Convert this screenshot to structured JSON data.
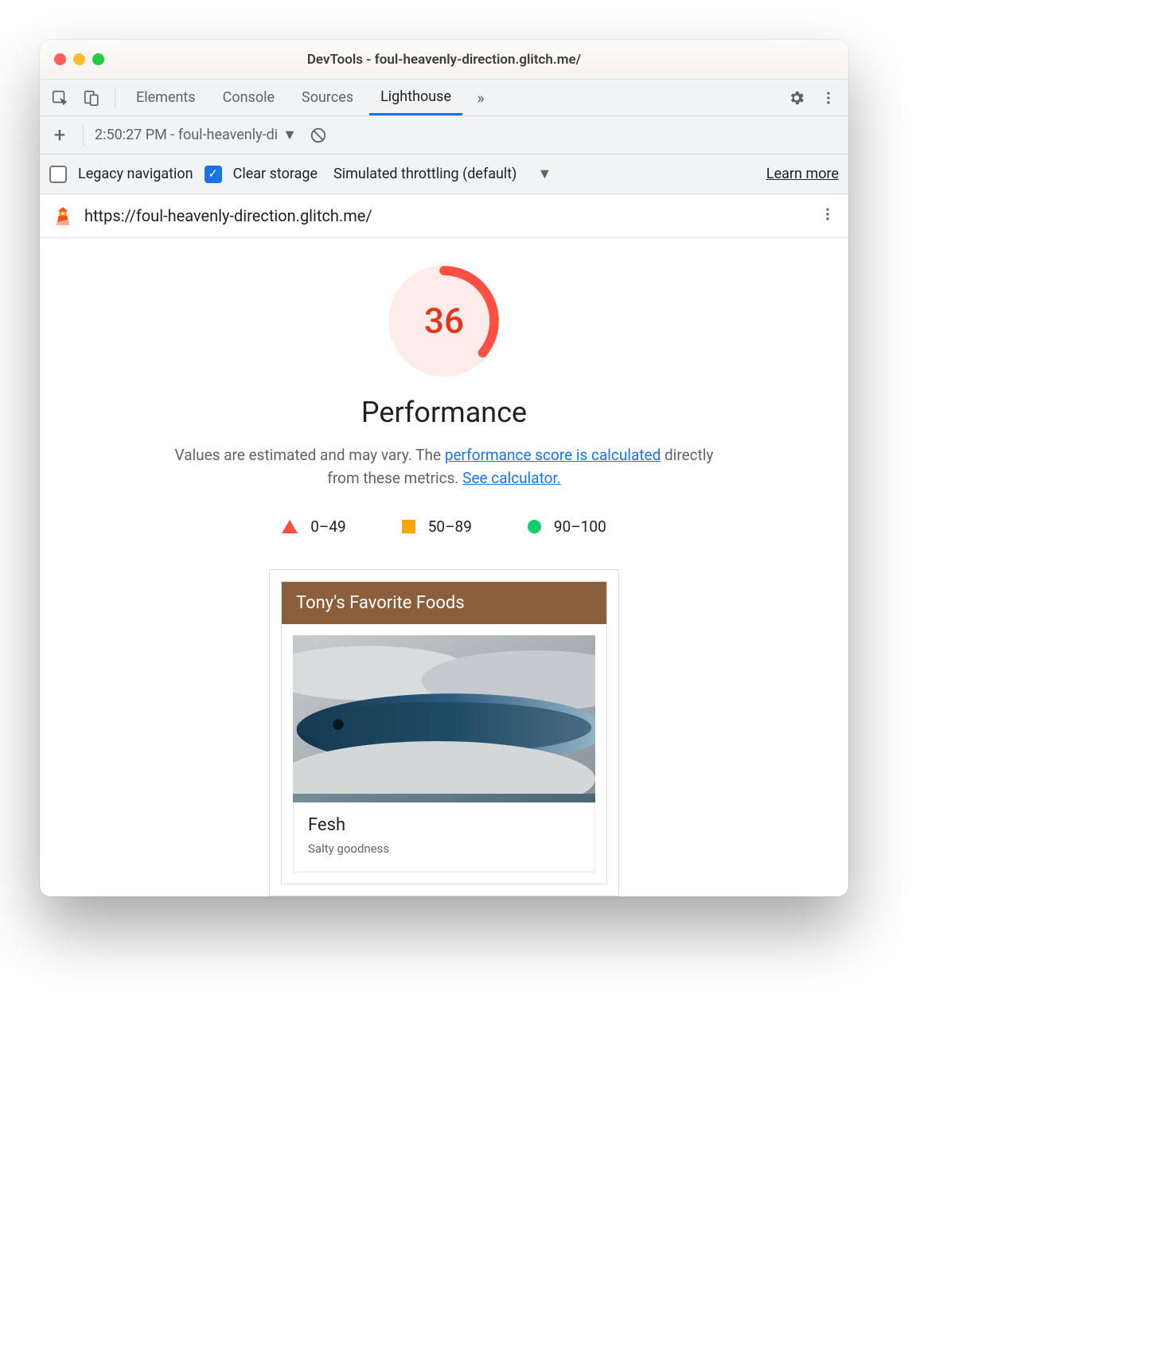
{
  "window": {
    "title": "DevTools - foul-heavenly-direction.glitch.me/"
  },
  "tabs": {
    "items": [
      "Elements",
      "Console",
      "Sources",
      "Lighthouse"
    ],
    "active": "Lighthouse"
  },
  "secondary": {
    "report_selector": "2:50:27 PM - foul-heavenly-di"
  },
  "options": {
    "legacy_label": "Legacy navigation",
    "legacy_checked": false,
    "clear_label": "Clear storage",
    "clear_checked": true,
    "throttling_label": "Simulated throttling (default)",
    "learn_more": "Learn more"
  },
  "report": {
    "url": "https://foul-heavenly-direction.glitch.me/",
    "score": "36",
    "score_arc_fraction": 0.36,
    "category": "Performance",
    "desc_pre": "Values are estimated and may vary. The ",
    "desc_link1": "performance score is calculated",
    "desc_mid": " directly from these metrics. ",
    "desc_link2": "See calculator.",
    "legend": {
      "fail": "0–49",
      "avg": "50–89",
      "pass": "90–100"
    },
    "colors": {
      "fail": "#ff4e42",
      "avg": "#ffa400",
      "pass": "#0cce6b"
    }
  },
  "screenshot": {
    "header": "Tony's Favorite Foods",
    "item_title": "Fesh",
    "item_sub": "Salty goodness"
  }
}
